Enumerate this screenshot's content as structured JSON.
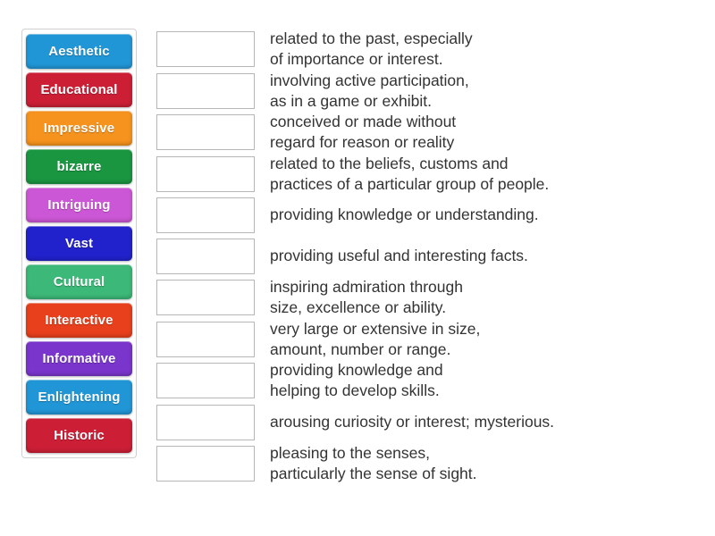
{
  "activity": {
    "type": "match-up",
    "tiles_panel_label": "word-tiles",
    "tiles": [
      {
        "label": "Aesthetic",
        "color": "#2196d6"
      },
      {
        "label": "Educational",
        "color": "#cc1f36"
      },
      {
        "label": "Impressive",
        "color": "#f6931e"
      },
      {
        "label": "bizarre",
        "color": "#1a9641"
      },
      {
        "label": "Intriguing",
        "color": "#cc57d6"
      },
      {
        "label": "Vast",
        "color": "#2222cc"
      },
      {
        "label": "Cultural",
        "color": "#3cb878"
      },
      {
        "label": "Interactive",
        "color": "#e8401c"
      },
      {
        "label": "Informative",
        "color": "#7a35cc"
      },
      {
        "label": "Enlightening",
        "color": "#2196d6"
      },
      {
        "label": "Historic",
        "color": "#cc1f36"
      }
    ],
    "rows": [
      {
        "answer": "",
        "definition": "related to the past, especially\nof importance or interest."
      },
      {
        "answer": "",
        "definition": "involving active participation,\nas in a game or exhibit."
      },
      {
        "answer": "",
        "definition": "conceived or made without\nregard for reason or reality"
      },
      {
        "answer": "",
        "definition": "related to the beliefs, customs and\npractices of a particular group of people."
      },
      {
        "answer": "",
        "definition": "providing knowledge or understanding."
      },
      {
        "answer": "",
        "definition": "providing useful and interesting facts."
      },
      {
        "answer": "",
        "definition": "inspiring admiration through\nsize, excellence or ability."
      },
      {
        "answer": "",
        "definition": "very large or extensive in size,\namount, number or range."
      },
      {
        "answer": "",
        "definition": "providing knowledge and\nhelping to develop skills."
      },
      {
        "answer": "",
        "definition": "arousing curiosity or interest; mysterious."
      },
      {
        "answer": "",
        "definition": "pleasing to the senses,\nparticularly the sense of sight."
      }
    ]
  }
}
